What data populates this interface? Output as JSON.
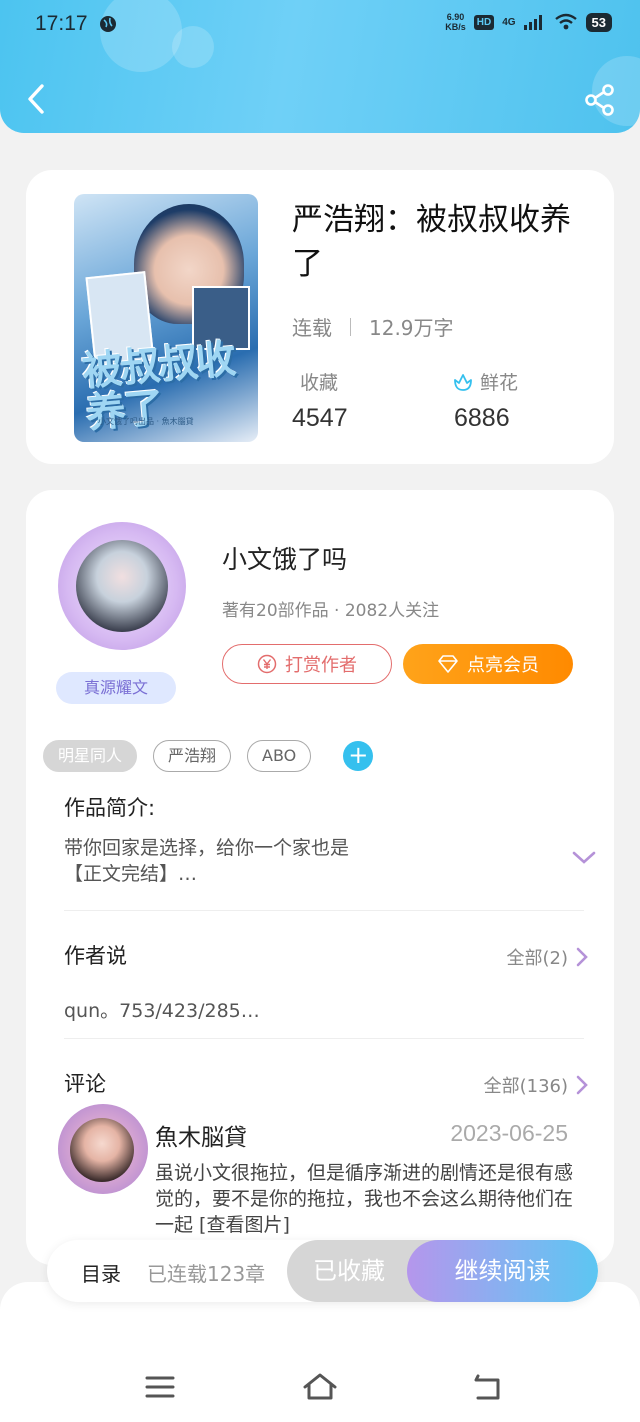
{
  "status_bar": {
    "time": "17:17",
    "speed": "6.90",
    "speed_unit": "KB/s",
    "hd": "HD",
    "network": "4G",
    "battery": "53"
  },
  "header": {
    "back_icon": "chevron-left-icon",
    "share_icon": "share-icon"
  },
  "book": {
    "cover_title": "被叔叔收养了",
    "cover_subtitle": "小文饿了吗出品 · 魚木腦貸",
    "title": "严浩翔：被叔叔收养了",
    "status": "连载",
    "word_count": "12.9万字",
    "favorites_label": "收藏",
    "favorites_value": "4547",
    "flowers_label": "鲜花",
    "flowers_value": "6886"
  },
  "author": {
    "name": "小文饿了吗",
    "meta": "著有20部作品 · 2082人关注",
    "badge": "真源耀文",
    "reward_label": "打赏作者",
    "vip_label": "点亮会员"
  },
  "tags": [
    "明星同人",
    "严浩翔",
    "ABO"
  ],
  "intro": {
    "title": "作品简介:",
    "line1": "带你回家是选择，给你一个家也是",
    "line2": "【正文完结】…"
  },
  "author_says": {
    "title": "作者说",
    "all_label": "全部(2)",
    "text": "qun。753/423/285…"
  },
  "comments": {
    "title": "评论",
    "all_label": "全部(136)",
    "items": [
      {
        "name": "魚木脳貸",
        "date": "2023-06-25",
        "text": "虽说小文很拖拉，但是循序渐进的剧情还是很有感觉的，要不是你的拖拉，我也不会这么期待他们在一起 [查看图片]"
      }
    ]
  },
  "bottom_bar": {
    "toc_label": "目录",
    "toc_count": "已连载123章",
    "collected_label": "已收藏",
    "read_label": "继续阅读"
  },
  "colors": {
    "header": "#4cc4f0",
    "accent_orange": "#ff8a00",
    "reward_red": "#e36d6d",
    "tag_add": "#35c0ee",
    "chevron_purple": "#b592d8"
  }
}
